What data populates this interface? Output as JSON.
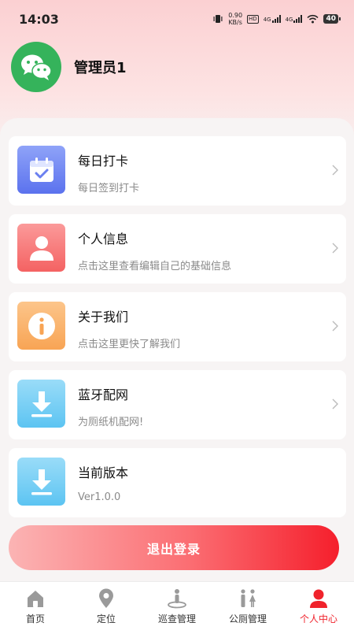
{
  "status_bar": {
    "time": "14:03",
    "net_speed_value": "0.90",
    "net_speed_unit": "KB/s",
    "hd_label": "HD",
    "signal1": "4G",
    "signal2": "4G",
    "battery": "40"
  },
  "profile": {
    "name": "管理员1",
    "avatar_icon": "wechat-icon",
    "avatar_color": "#35b35b"
  },
  "menu": [
    {
      "title": "每日打卡",
      "subtitle": "每日签到打卡",
      "icon": "calendar-check-icon",
      "color_from": "#8fa3f8",
      "color_to": "#5b72ee"
    },
    {
      "title": "个人信息",
      "subtitle": "点击这里查看编辑自己的基础信息",
      "icon": "user-icon",
      "color_from": "#fb9a9a",
      "color_to": "#f46262"
    },
    {
      "title": "关于我们",
      "subtitle": "点击这里更快了解我们",
      "icon": "info-icon",
      "color_from": "#fcc58a",
      "color_to": "#f8a454"
    },
    {
      "title": "蓝牙配网",
      "subtitle": "为厕纸机配网!",
      "icon": "download-icon",
      "color_from": "#9adcf8",
      "color_to": "#5cc4f2"
    },
    {
      "title": "当前版本",
      "subtitle": "Ver1.0.0",
      "icon": "download-icon",
      "color_from": "#9adcf8",
      "color_to": "#5cc4f2"
    }
  ],
  "logout_label": "退出登录",
  "tabbar": {
    "active_color": "#f0232c",
    "items": [
      {
        "label": "首页",
        "icon": "home-icon"
      },
      {
        "label": "定位",
        "icon": "location-pin-icon"
      },
      {
        "label": "巡查管理",
        "icon": "patrol-person-icon"
      },
      {
        "label": "公厕管理",
        "icon": "restroom-icon"
      },
      {
        "label": "个人中心",
        "icon": "profile-icon",
        "active": true
      }
    ]
  }
}
